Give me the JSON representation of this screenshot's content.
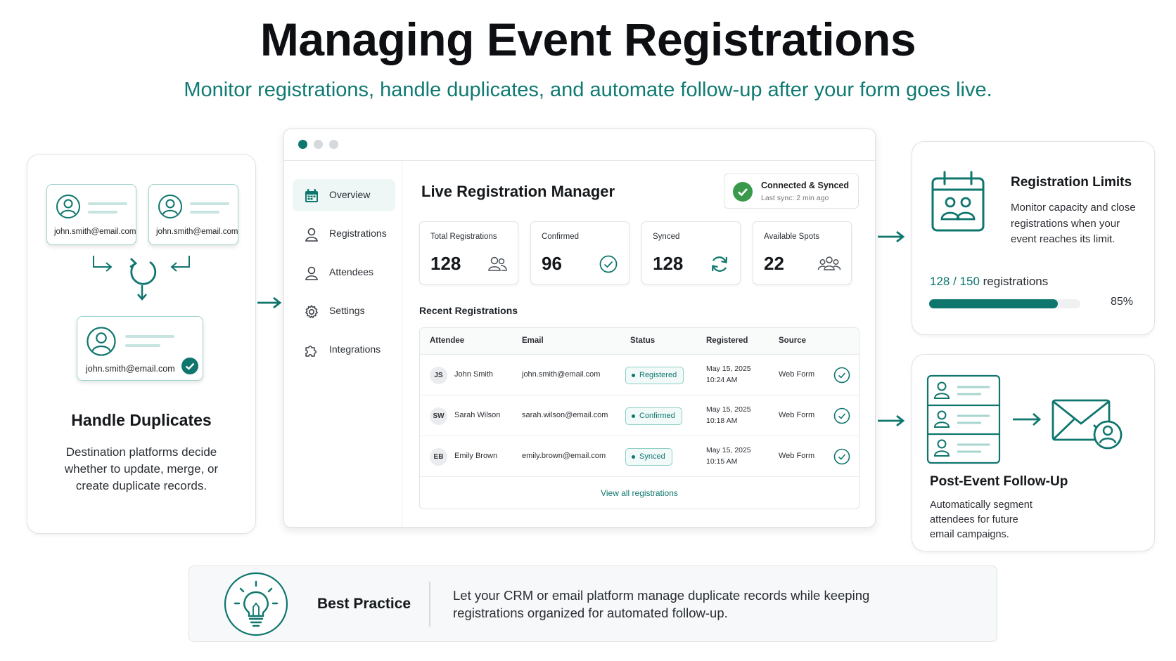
{
  "header": {
    "title": "Managing Event Registrations",
    "subtitle": "Monitor registrations, handle duplicates, and automate follow-up after your form goes live."
  },
  "duplicates": {
    "email_a": "john.smith@email.com",
    "email_b": "john.smith@email.com",
    "email_merged": "john.smith@email.com",
    "title": "Handle Duplicates",
    "description_lines": [
      "Destination platforms decide",
      "whether to update, merge, or",
      "create duplicate records."
    ]
  },
  "window": {
    "sidebar": {
      "items": [
        {
          "label": "Overview",
          "icon": "calendar-icon",
          "active": true
        },
        {
          "label": "Registrations",
          "icon": "user-icon"
        },
        {
          "label": "Attendees",
          "icon": "user-icon"
        },
        {
          "label": "Settings",
          "icon": "gear-icon"
        },
        {
          "label": "Integrations",
          "icon": "puzzle-icon"
        }
      ]
    },
    "title": "Live Registration Manager",
    "sync": {
      "title": "Connected & Synced",
      "subtitle": "Last sync: 2 min ago"
    },
    "stats": [
      {
        "label": "Total Registrations",
        "value": "128",
        "icon": "people-icon"
      },
      {
        "label": "Confirmed",
        "value": "96",
        "icon": "check-circle-icon"
      },
      {
        "label": "Synced",
        "value": "128",
        "icon": "sync-icon"
      },
      {
        "label": "Available Spots",
        "value": "22",
        "icon": "group-icon"
      }
    ],
    "recent_title": "Recent Registrations",
    "table": {
      "columns": [
        "Attendee",
        "Email",
        "Status",
        "Registered",
        "Source"
      ],
      "rows": [
        {
          "initials": "JS",
          "name": "John Smith",
          "email": "john.smith@email.com",
          "status": "Registered",
          "date": "May 15, 2025",
          "time": "10:24 AM",
          "source": "Web Form"
        },
        {
          "initials": "SW",
          "name": "Sarah Wilson",
          "email": "sarah.wilson@email.com",
          "status": "Confirmed",
          "date": "May 15, 2025",
          "time": "10:18 AM",
          "source": "Web Form"
        },
        {
          "initials": "EB",
          "name": "Emily Brown",
          "email": "emily.brown@email.com",
          "status": "Synced",
          "date": "May 15, 2025",
          "time": "10:15 AM",
          "source": "Web Form"
        }
      ],
      "view_all": "View all registrations"
    }
  },
  "limits": {
    "title": "Registration Limits",
    "description_lines": [
      "Monitor capacity and close",
      "registrations when your",
      "event reaches its limit."
    ],
    "count": "128",
    "separator": " / ",
    "capacity": "150",
    "count_suffix": " registrations",
    "percent_label": "85%",
    "fill_fraction": 0.85
  },
  "followup": {
    "title": "Post-Event Follow-Up",
    "description_lines": [
      "Automatically segment",
      "attendees for future",
      "email campaigns."
    ]
  },
  "best_practice": {
    "title": "Best Practice",
    "text": "Let your CRM or email platform manage duplicate records while keeping registrations organized for automated follow-up."
  },
  "colors": {
    "accent": "#0f766e",
    "success": "#3a9a4c",
    "text": "#15181b"
  }
}
